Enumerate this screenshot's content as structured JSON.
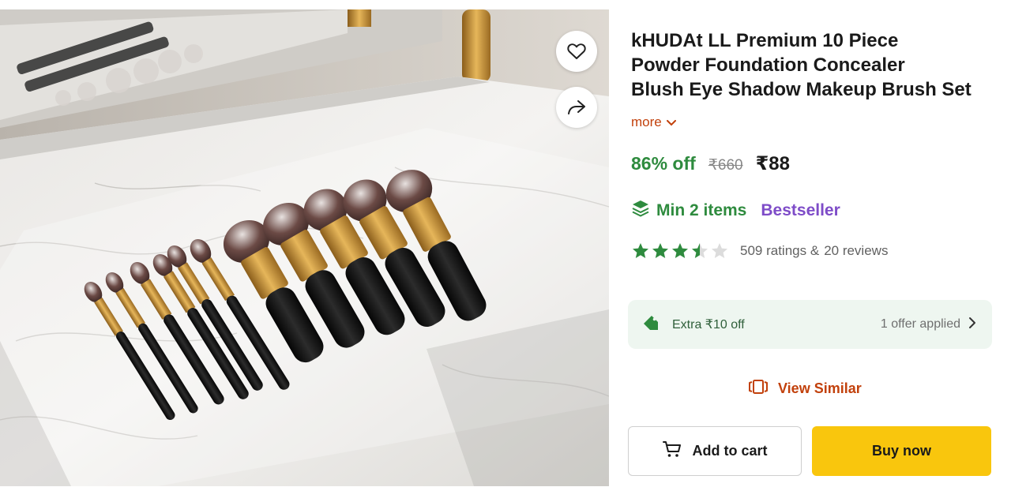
{
  "product": {
    "title_line1": "kHUDAt LL Premium 10 Piece",
    "title_line2": "Powder Foundation Concealer",
    "title_line3": "Blush Eye Shadow Makeup Brush Set",
    "more_label": "more"
  },
  "pricing": {
    "discount": "86% off",
    "mrp": "₹660",
    "price": "₹88"
  },
  "tags": {
    "min_items": "Min 2 items",
    "bestseller": "Bestseller"
  },
  "rating": {
    "stars": 3.5,
    "ratings_text": "509 ratings &",
    "reviews_text": "20 reviews"
  },
  "offer": {
    "text": "Extra ₹10 off",
    "applied": "1 offer applied"
  },
  "actions": {
    "view_similar": "View Similar",
    "add_to_cart": "Add to cart",
    "buy_now": "Buy now"
  },
  "icons": {
    "wishlist": "heart-icon",
    "share": "share-icon",
    "stack": "stack-icon",
    "tag": "tag-icon",
    "similar": "similar-icon",
    "cart": "cart-icon",
    "chevron": "chevron-right-icon"
  },
  "colors": {
    "discount_green": "#2e8b3e",
    "bestseller_purple": "#7e4cc8",
    "accent_orange": "#c2410c",
    "buy_yellow": "#f9c60d",
    "offer_bg": "#eef6f0"
  }
}
